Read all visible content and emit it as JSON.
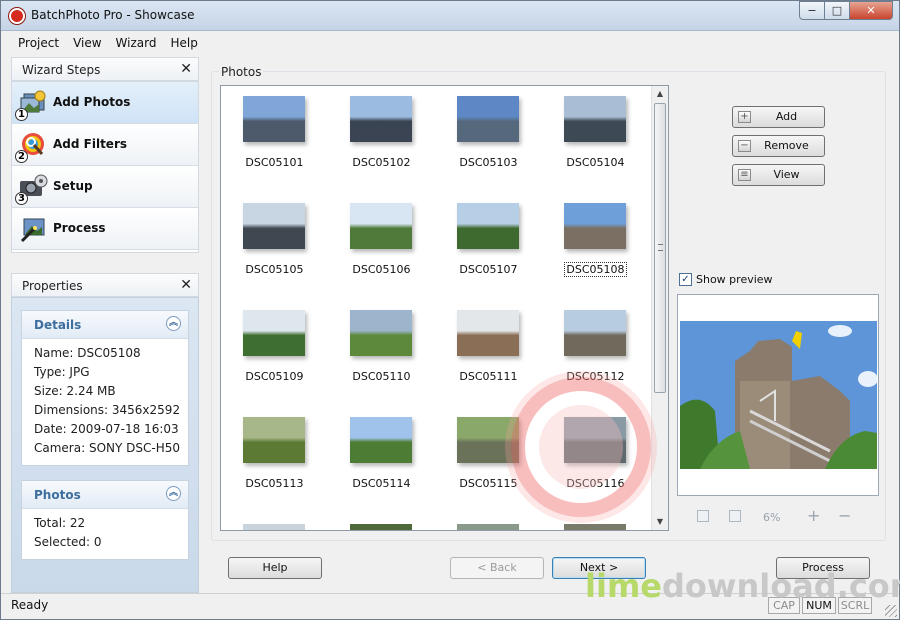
{
  "window": {
    "title": "BatchPhoto Pro - Showcase",
    "min_glyph": "−",
    "max_glyph": "□",
    "close_glyph": "✕"
  },
  "menu": [
    "Project",
    "View",
    "Wizard",
    "Help"
  ],
  "wizard": {
    "title": "Wizard Steps",
    "close_glyph": "✕",
    "steps": [
      {
        "num": "1",
        "label": "Add Photos",
        "active": true
      },
      {
        "num": "2",
        "label": "Add Filters",
        "active": false
      },
      {
        "num": "3",
        "label": "Setup",
        "active": false
      },
      {
        "num": "",
        "label": "Process",
        "active": false
      }
    ]
  },
  "properties": {
    "title": "Properties",
    "close_glyph": "✕",
    "collapse_glyph": "︽",
    "details": {
      "title": "Details",
      "rows": [
        "Name: DSC05108",
        "Type: JPG",
        "Size: 2.24 MB",
        "Dimensions: 3456x2592",
        "Date: 2009-07-18 16:03",
        "Camera: SONY DSC-H50"
      ]
    },
    "photos": {
      "title": "Photos",
      "rows": [
        "Total: 22",
        "Selected: 0"
      ]
    }
  },
  "photos_group": {
    "label": "Photos"
  },
  "thumbnails": [
    {
      "name": "DSC05101",
      "sky": "#7fa6d6",
      "land": "#4c5a6b"
    },
    {
      "name": "DSC05102",
      "sky": "#9bbbe0",
      "land": "#3a4452"
    },
    {
      "name": "DSC05103",
      "sky": "#5e88c5",
      "land": "#56687c"
    },
    {
      "name": "DSC05104",
      "sky": "#a9bdd4",
      "land": "#3d4a55"
    },
    {
      "name": "DSC05105",
      "sky": "#c8d6e4",
      "land": "#3f4751"
    },
    {
      "name": "DSC05106",
      "sky": "#d7e6f2",
      "land": "#4f7a3a"
    },
    {
      "name": "DSC05107",
      "sky": "#b6cfe6",
      "land": "#3f6a2f"
    },
    {
      "name": "DSC05108",
      "sky": "#6f9fd8",
      "land": "#7a6f62",
      "selected": true
    },
    {
      "name": "DSC05109",
      "sky": "#dfe7ee",
      "land": "#3e6e30"
    },
    {
      "name": "DSC05110",
      "sky": "#9db5cc",
      "land": "#5d8a3a"
    },
    {
      "name": "DSC05111",
      "sky": "#e3e7ea",
      "land": "#8a6e55"
    },
    {
      "name": "DSC05112",
      "sky": "#b8cce0",
      "land": "#6f6a5c"
    },
    {
      "name": "DSC05113",
      "sky": "#a7b789",
      "land": "#5c7a33"
    },
    {
      "name": "DSC05114",
      "sky": "#9fc3ea",
      "land": "#4d7d34"
    },
    {
      "name": "DSC05115",
      "sky": "#8aa86a",
      "land": "#6a7359"
    },
    {
      "name": "DSC05116",
      "sky": "#8a9aa5",
      "land": "#5e6a6d"
    }
  ],
  "partial_row": [
    "#c9d3dc",
    "#4f6a3a",
    "#8a9a8a",
    "#7a7a6a"
  ],
  "side_buttons": [
    {
      "label": "Add",
      "icon": "+"
    },
    {
      "label": "Remove",
      "icon": "−"
    },
    {
      "label": "View",
      "icon": "≡"
    }
  ],
  "preview": {
    "checkbox_label": "Show preview",
    "checked": true,
    "check_glyph": "✓",
    "zoom_text": "6%",
    "zoom_in_glyph": "+",
    "zoom_out_glyph": "−"
  },
  "nav": {
    "help": "Help",
    "back": "< Back",
    "next": "Next >",
    "process": "Process"
  },
  "status": {
    "text": "Ready",
    "cap": "CAP",
    "num": "NUM",
    "scrl": "SCRL"
  },
  "watermark": {
    "part1": "lime",
    "part2": "download.com"
  },
  "colors": {
    "accent": "#3d6e9e",
    "close": "#c8452f",
    "watermark_green": "#b7d96a"
  }
}
